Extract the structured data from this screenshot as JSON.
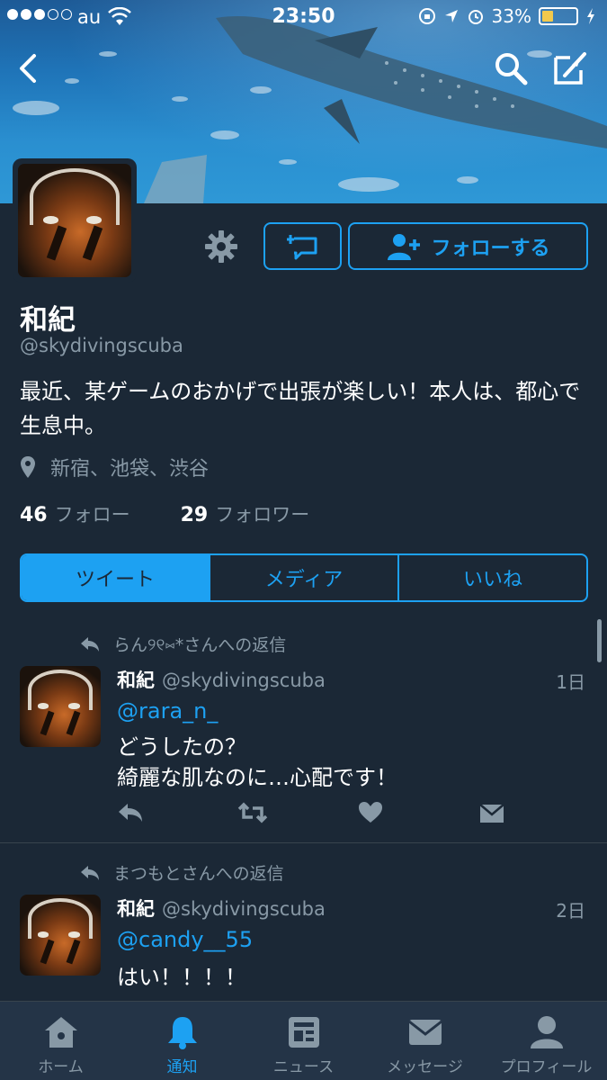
{
  "status_bar": {
    "carrier": "au",
    "time": "23:50",
    "battery_pct": "33%",
    "battery_level": 0.33,
    "signal_bars": 3,
    "signal_total": 5
  },
  "nav": {
    "back_icon": "chevron-left-icon",
    "search_icon": "search-icon",
    "compose_icon": "compose-icon"
  },
  "profile": {
    "name": "和紀",
    "handle": "@skydivingscuba",
    "bio": "最近、某ゲームのおかげで出張が楽しい！本人は、都心で生息中。",
    "location": "新宿、池袋、渋谷",
    "following_count": "46",
    "following_label": "フォロー",
    "followers_count": "29",
    "followers_label": "フォロワー",
    "follow_button": "フォローする"
  },
  "tabs": [
    {
      "label": "ツイート",
      "active": true
    },
    {
      "label": "メディア",
      "active": false
    },
    {
      "label": "いいね",
      "active": false
    }
  ],
  "tweets": [
    {
      "reply_context": "らん୨୧⑅*さんへの返信",
      "name": "和紀",
      "handle": "@skydivingscuba",
      "time": "1日",
      "mention": "@rara_n_",
      "lines": [
        "どうしたの？",
        "綺麗な肌なのに…心配です！"
      ]
    },
    {
      "reply_context": "まつもとさんへの返信",
      "name": "和紀",
      "handle": "@skydivingscuba",
      "time": "2日",
      "mention": "@candy__55",
      "lines": [
        "はい！！！！"
      ]
    }
  ],
  "tabbar": [
    {
      "label": "ホーム",
      "icon": "home-icon",
      "active": false
    },
    {
      "label": "通知",
      "icon": "bell-icon",
      "active": true
    },
    {
      "label": "ニュース",
      "icon": "news-icon",
      "active": false
    },
    {
      "label": "メッセージ",
      "icon": "envelope-icon",
      "active": false
    },
    {
      "label": "プロフィール",
      "icon": "person-icon",
      "active": false
    }
  ],
  "colors": {
    "background": "#1b2836",
    "accent": "#1da1f2",
    "muted": "#8899a6",
    "tabbar": "#243447"
  }
}
